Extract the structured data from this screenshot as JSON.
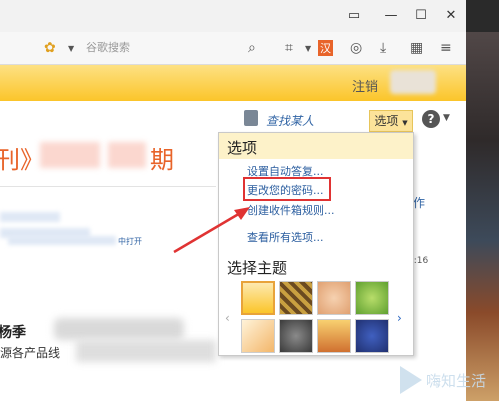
{
  "toolbar": {
    "search_placeholder": "谷歌搜索"
  },
  "header": {
    "signout": "注销"
  },
  "page": {
    "find_people": "查找某人",
    "options_label": "选项",
    "heading_left": "刊》",
    "heading_right": "期",
    "action_link": "作",
    "time": "5:16",
    "sender_name": "杨季",
    "sender_line2": "源各产品线",
    "small_link": "中打开"
  },
  "dropdown": {
    "title": "选项",
    "items": [
      "设置自动答复...",
      "更改您的密码...",
      "创建收件箱规则...",
      "查看所有选项..."
    ],
    "theme_title": "选择主题"
  },
  "colors": {
    "accent_orange": "#e8642a",
    "link_blue": "#2a5d9f",
    "highlight_red": "#e03333",
    "band_gold": "#fbc52a"
  },
  "watermark": {
    "text": "嗨知生活"
  }
}
